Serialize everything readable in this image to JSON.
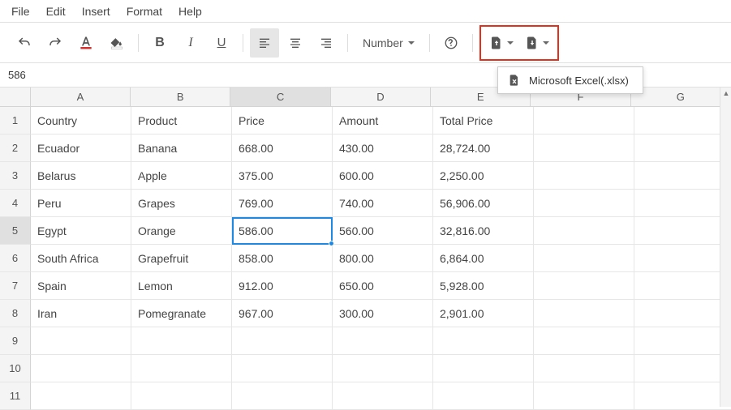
{
  "menu": {
    "file": "File",
    "edit": "Edit",
    "insert": "Insert",
    "format": "Format",
    "help": "Help"
  },
  "toolbar": {
    "number_label": "Number"
  },
  "dropdown": {
    "excel": "Microsoft Excel(.xlsx)"
  },
  "formula_bar": {
    "value": "586"
  },
  "columns": [
    "A",
    "B",
    "C",
    "D",
    "E",
    "F",
    "G"
  ],
  "rows": [
    "1",
    "2",
    "3",
    "4",
    "5",
    "6",
    "7",
    "8",
    "9",
    "10",
    "11"
  ],
  "selected_col": "C",
  "selected_row": "5",
  "chart_data": {
    "type": "table",
    "headers": [
      "Country",
      "Product",
      "Price",
      "Amount",
      "Total Price"
    ],
    "rows": [
      [
        "Ecuador",
        "Banana",
        "668.00",
        "430.00",
        "28,724.00"
      ],
      [
        "Belarus",
        "Apple",
        "375.00",
        "600.00",
        "2,250.00"
      ],
      [
        "Peru",
        "Grapes",
        "769.00",
        "740.00",
        "56,906.00"
      ],
      [
        "Egypt",
        "Orange",
        "586.00",
        "560.00",
        "32,816.00"
      ],
      [
        "South Africa",
        "Grapefruit",
        "858.00",
        "800.00",
        "6,864.00"
      ],
      [
        "Spain",
        "Lemon",
        "912.00",
        "650.00",
        "5,928.00"
      ],
      [
        "Iran",
        "Pomegranate",
        "967.00",
        "300.00",
        "2,901.00"
      ]
    ]
  },
  "cells": {
    "r1": {
      "A": "Country",
      "B": "Product",
      "C": "Price",
      "D": "Amount",
      "E": "Total Price"
    },
    "r2": {
      "A": "Ecuador",
      "B": "Banana",
      "C": "668.00",
      "D": "430.00",
      "E": "28,724.00"
    },
    "r3": {
      "A": "Belarus",
      "B": "Apple",
      "C": "375.00",
      "D": "600.00",
      "E": "2,250.00"
    },
    "r4": {
      "A": "Peru",
      "B": "Grapes",
      "C": "769.00",
      "D": "740.00",
      "E": "56,906.00"
    },
    "r5": {
      "A": "Egypt",
      "B": "Orange",
      "C": "586.00",
      "D": "560.00",
      "E": "32,816.00"
    },
    "r6": {
      "A": "South Africa",
      "B": "Grapefruit",
      "C": "858.00",
      "D": "800.00",
      "E": "6,864.00"
    },
    "r7": {
      "A": "Spain",
      "B": "Lemon",
      "C": "912.00",
      "D": "650.00",
      "E": "5,928.00"
    },
    "r8": {
      "A": "Iran",
      "B": "Pomegranate",
      "C": "967.00",
      "D": "300.00",
      "E": "2,901.00"
    }
  }
}
